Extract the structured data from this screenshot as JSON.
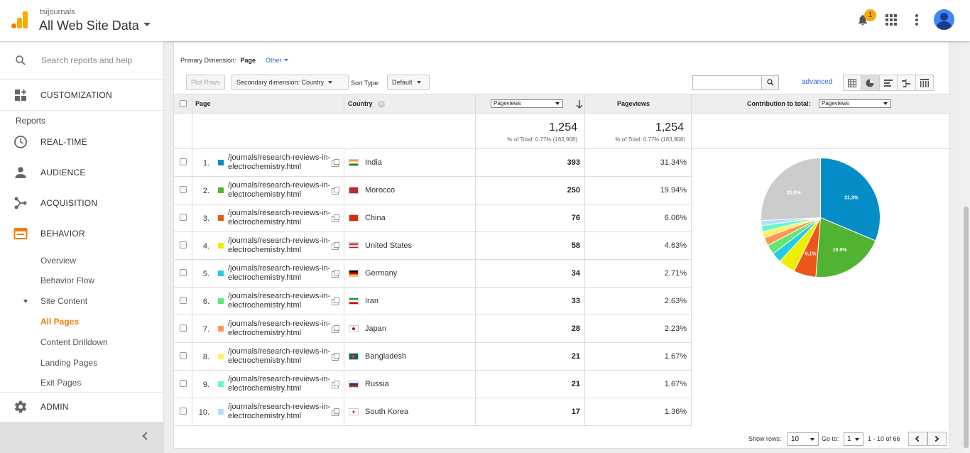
{
  "header": {
    "account": "tsijournals",
    "property": "All Web Site Data",
    "notification_count": "1"
  },
  "sidebar": {
    "search_placeholder": "Search reports and help",
    "customization": "CUSTOMIZATION",
    "reports_label": "Reports",
    "realtime": "REAL-TIME",
    "audience": "AUDIENCE",
    "acquisition": "ACQUISITION",
    "behavior": "BEHAVIOR",
    "behavior_items": [
      "Overview",
      "Behavior Flow",
      "Site Content",
      "All Pages",
      "Content Drilldown",
      "Landing Pages",
      "Exit Pages"
    ],
    "admin": "ADMIN"
  },
  "controls": {
    "primary_dimension_label": "Primary Dimension:",
    "primary_dimension_value": "Page",
    "other": "Other",
    "plot_rows": "Plot Rows",
    "secondary_dimension": "Secondary dimension: Country",
    "sort_type_label": "Sort Type:",
    "sort_type_value": "Default",
    "advanced": "advanced"
  },
  "table": {
    "col_page": "Page",
    "col_country": "Country",
    "metric_select": "Pageviews",
    "col_pageviews": "Pageviews",
    "contribution_label": "Contribution to total:",
    "contribution_select": "Pageviews",
    "total_1": "1,254",
    "total_1_pct": "% of Total: 0.77% (163,908)",
    "total_2": "1,254",
    "total_2_pct": "% of Total: 0.77% (163,908)",
    "rows": [
      {
        "num": "1.",
        "page": "/journals/research-reviews-in-electrochemistry.html",
        "country": "India",
        "pageviews": "393",
        "pct": "31.34%",
        "color": "#058dc7"
      },
      {
        "num": "2.",
        "page": "/journals/research-reviews-in-electrochemistry.html",
        "country": "Morocco",
        "pageviews": "250",
        "pct": "19.94%",
        "color": "#50b432"
      },
      {
        "num": "3.",
        "page": "/journals/research-reviews-in-electrochemistry.html",
        "country": "China",
        "pageviews": "76",
        "pct": "6.06%",
        "color": "#ed561b"
      },
      {
        "num": "4.",
        "page": "/journals/research-reviews-in-electrochemistry.html",
        "country": "United States",
        "pageviews": "58",
        "pct": "4.63%",
        "color": "#edef00"
      },
      {
        "num": "5.",
        "page": "/journals/research-reviews-in-electrochemistry.html",
        "country": "Germany",
        "pageviews": "34",
        "pct": "2.71%",
        "color": "#24cbe5"
      },
      {
        "num": "6.",
        "page": "/journals/research-reviews-in-electrochemistry.html",
        "country": "Iran",
        "pageviews": "33",
        "pct": "2.63%",
        "color": "#64e572"
      },
      {
        "num": "7.",
        "page": "/journals/research-reviews-in-electrochemistry.html",
        "country": "Japan",
        "pageviews": "28",
        "pct": "2.23%",
        "color": "#ff9655"
      },
      {
        "num": "8.",
        "page": "/journals/research-reviews-in-electrochemistry.html",
        "country": "Bangladesh",
        "pageviews": "21",
        "pct": "1.67%",
        "color": "#fff263"
      },
      {
        "num": "9.",
        "page": "/journals/research-reviews-in-electrochemistry.html",
        "country": "Russia",
        "pageviews": "21",
        "pct": "1.67%",
        "color": "#6af9c4"
      },
      {
        "num": "10.",
        "page": "/journals/research-reviews-in-electrochemistry.html",
        "country": "South Korea",
        "pageviews": "17",
        "pct": "1.36%",
        "color": "#b2deff"
      }
    ]
  },
  "pie": {
    "other_pct": 25.8,
    "other_color": "#cccccc",
    "labels": [
      {
        "text": "31.3%",
        "slice": 0
      },
      {
        "text": "19.9%",
        "slice": 1
      },
      {
        "text": "6.1%",
        "slice": 2
      },
      {
        "text": "25.8%",
        "slice": "other"
      }
    ]
  },
  "footer": {
    "show_rows_label": "Show rows:",
    "show_rows_value": "10",
    "goto_label": "Go to:",
    "goto_value": "1",
    "range": "1 - 10 of 66"
  }
}
